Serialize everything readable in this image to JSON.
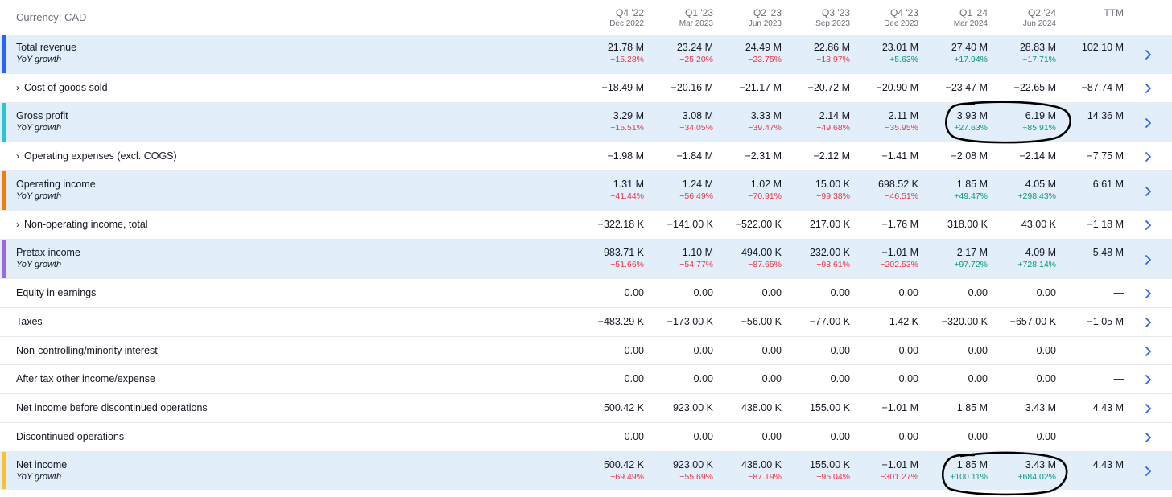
{
  "currency_label": "Currency: CAD",
  "columns": [
    {
      "quarter": "Q4 '22",
      "date": "Dec 2022"
    },
    {
      "quarter": "Q1 '23",
      "date": "Mar 2023"
    },
    {
      "quarter": "Q2 '23",
      "date": "Jun 2023"
    },
    {
      "quarter": "Q3 '23",
      "date": "Sep 2023"
    },
    {
      "quarter": "Q4 '23",
      "date": "Dec 2023"
    },
    {
      "quarter": "Q1 '24",
      "date": "Mar 2024"
    },
    {
      "quarter": "Q2 '24",
      "date": "Jun 2024"
    }
  ],
  "ttm_label": "TTM",
  "colors": {
    "revenue": "#2962ff",
    "gross_profit": "#26c6da",
    "operating_income": "#f57c00",
    "pretax_income": "#9c6ade",
    "net_income": "#fbc02d",
    "highlight_bg": "#e3eefb",
    "negative": "#f23645",
    "positive": "#089981"
  },
  "rows": [
    {
      "label": "Total revenue",
      "sublabel": "YoY growth",
      "highlight": true,
      "accent": "revenue",
      "expandable": false,
      "values": [
        "21.78 M",
        "23.24 M",
        "24.49 M",
        "22.86 M",
        "23.01 M",
        "27.40 M",
        "28.83 M"
      ],
      "growth": [
        "−15.28%",
        "−25.20%",
        "−23.75%",
        "−13.97%",
        "+5.63%",
        "+17.94%",
        "+17.71%"
      ],
      "ttm": "102.10 M"
    },
    {
      "label": "Cost of goods sold",
      "highlight": false,
      "expandable": true,
      "values": [
        "−18.49 M",
        "−20.16 M",
        "−21.17 M",
        "−20.72 M",
        "−20.90 M",
        "−23.47 M",
        "−22.65 M"
      ],
      "ttm": "−87.74 M"
    },
    {
      "label": "Gross profit",
      "sublabel": "YoY growth",
      "highlight": true,
      "accent": "gross_profit",
      "expandable": false,
      "values": [
        "3.29 M",
        "3.08 M",
        "3.33 M",
        "2.14 M",
        "2.11 M",
        "3.93 M",
        "6.19 M"
      ],
      "growth": [
        "−15.51%",
        "−34.05%",
        "−39.47%",
        "−49.68%",
        "−35.95%",
        "+27.63%",
        "+85.91%"
      ],
      "ttm": "14.36 M"
    },
    {
      "label": "Operating expenses (excl. COGS)",
      "highlight": false,
      "expandable": true,
      "values": [
        "−1.98 M",
        "−1.84 M",
        "−2.31 M",
        "−2.12 M",
        "−1.41 M",
        "−2.08 M",
        "−2.14 M"
      ],
      "ttm": "−7.75 M"
    },
    {
      "label": "Operating income",
      "sublabel": "YoY growth",
      "highlight": true,
      "accent": "operating_income",
      "expandable": false,
      "values": [
        "1.31 M",
        "1.24 M",
        "1.02 M",
        "15.00 K",
        "698.52 K",
        "1.85 M",
        "4.05 M"
      ],
      "growth": [
        "−41.44%",
        "−56.49%",
        "−70.91%",
        "−99.38%",
        "−46.51%",
        "+49.47%",
        "+298.43%"
      ],
      "ttm": "6.61 M"
    },
    {
      "label": "Non-operating income, total",
      "highlight": false,
      "expandable": true,
      "values": [
        "−322.18 K",
        "−141.00 K",
        "−522.00 K",
        "217.00 K",
        "−1.76 M",
        "318.00 K",
        "43.00 K"
      ],
      "ttm": "−1.18 M"
    },
    {
      "label": "Pretax income",
      "sublabel": "YoY growth",
      "highlight": true,
      "accent": "pretax_income",
      "expandable": false,
      "values": [
        "983.71 K",
        "1.10 M",
        "494.00 K",
        "232.00 K",
        "−1.01 M",
        "2.17 M",
        "4.09 M"
      ],
      "growth": [
        "−51.66%",
        "−54.77%",
        "−87.65%",
        "−93.61%",
        "−202.53%",
        "+97.72%",
        "+728.14%"
      ],
      "ttm": "5.48 M"
    },
    {
      "label": "Equity in earnings",
      "highlight": false,
      "expandable": false,
      "values": [
        "0.00",
        "0.00",
        "0.00",
        "0.00",
        "0.00",
        "0.00",
        "0.00"
      ],
      "ttm": "—"
    },
    {
      "label": "Taxes",
      "highlight": false,
      "expandable": false,
      "values": [
        "−483.29 K",
        "−173.00 K",
        "−56.00 K",
        "−77.00 K",
        "1.42 K",
        "−320.00 K",
        "−657.00 K"
      ],
      "ttm": "−1.05 M"
    },
    {
      "label": "Non-controlling/minority interest",
      "highlight": false,
      "expandable": false,
      "values": [
        "0.00",
        "0.00",
        "0.00",
        "0.00",
        "0.00",
        "0.00",
        "0.00"
      ],
      "ttm": "—"
    },
    {
      "label": "After tax other income/expense",
      "highlight": false,
      "expandable": false,
      "values": [
        "0.00",
        "0.00",
        "0.00",
        "0.00",
        "0.00",
        "0.00",
        "0.00"
      ],
      "ttm": "—"
    },
    {
      "label": "Net income before discontinued operations",
      "highlight": false,
      "expandable": false,
      "values": [
        "500.42 K",
        "923.00 K",
        "438.00 K",
        "155.00 K",
        "−1.01 M",
        "1.85 M",
        "3.43 M"
      ],
      "ttm": "4.43 M"
    },
    {
      "label": "Discontinued operations",
      "highlight": false,
      "expandable": false,
      "values": [
        "0.00",
        "0.00",
        "0.00",
        "0.00",
        "0.00",
        "0.00",
        "0.00"
      ],
      "ttm": "—"
    },
    {
      "label": "Net income",
      "sublabel": "YoY growth",
      "highlight": true,
      "accent": "net_income",
      "expandable": false,
      "values": [
        "500.42 K",
        "923.00 K",
        "438.00 K",
        "155.00 K",
        "−1.01 M",
        "1.85 M",
        "3.43 M"
      ],
      "growth": [
        "−69.49%",
        "−55.69%",
        "−87.19%",
        "−95.04%",
        "−301.27%",
        "+100.11%",
        "+684.02%"
      ],
      "ttm": "4.43 M"
    }
  ]
}
